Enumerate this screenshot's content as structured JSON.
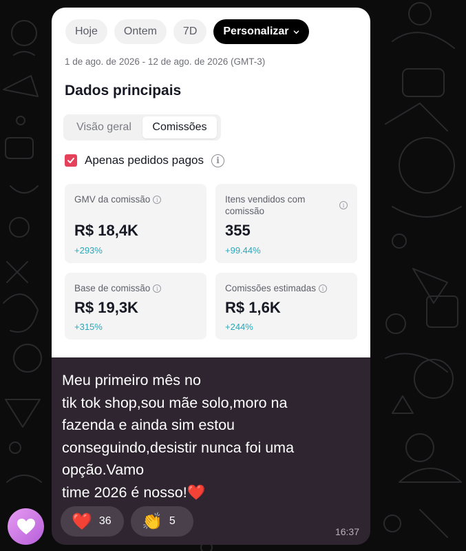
{
  "filters": {
    "today": "Hoje",
    "yesterday": "Ontem",
    "seven_days": "7D",
    "custom": "Personalizar"
  },
  "date_range": "1 de ago. de 2026 - 12 de ago. de 2026 (GMT-3)",
  "section_title": "Dados principais",
  "tabs": {
    "overview": "Visão geral",
    "commissions": "Comissões"
  },
  "paid_only": {
    "label": "Apenas pedidos pagos",
    "checked": true
  },
  "metrics": [
    {
      "label": "GMV da comissão",
      "value": "R$ 18,4K",
      "change": "+293%"
    },
    {
      "label": "Itens vendidos com comissão",
      "value": "355",
      "change": "+99.44%"
    },
    {
      "label": "Base de comissão",
      "value": "R$ 19,3K",
      "change": "+315%"
    },
    {
      "label": "Comissões estimadas",
      "value": "R$ 1,6K",
      "change": "+244%"
    }
  ],
  "message": {
    "text": "Meu primeiro mês no\ntik tok shop,sou mãe solo,moro na\nfazenda e ainda sim estou\nconseguindo,desistir nunca foi uma\nopção.Vamo\ntime 2026 é nosso!",
    "emoji": "❤️",
    "time": "16:37"
  },
  "reactions": [
    {
      "emoji": "❤️",
      "icon": "red-heart-icon",
      "count": "36"
    },
    {
      "emoji": "👏",
      "icon": "clapping-hands-icon",
      "count": "5"
    }
  ],
  "colors": {
    "accent_check": "#e5415a",
    "change_positive": "#2aa7b8",
    "bubble_bg": "#2f2531",
    "avatar": "#c878e6"
  }
}
